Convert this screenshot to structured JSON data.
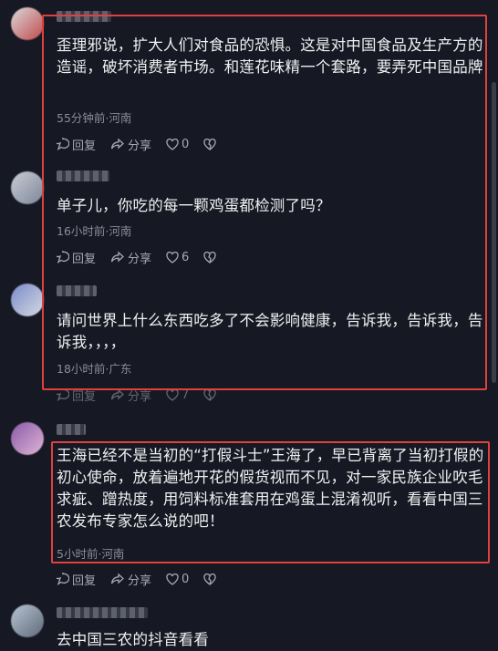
{
  "comments": [
    {
      "text": "歪理邪说，扩大人们对食品的恐惧。这是对中国食品及生产方的造谣，破坏消费者市场。和莲花味精一个套路，要弄死中国品牌",
      "meta": "55分钟前·河南",
      "reply": "回复",
      "share": "分享",
      "likes": "0"
    },
    {
      "text": "单子儿，你吃的每一颗鸡蛋都检测了吗？",
      "meta": "16小时前·河南",
      "reply": "回复",
      "share": "分享",
      "likes": "6"
    },
    {
      "text": "请问世界上什么东西吃多了不会影响健康，告诉我，告诉我，告诉我，，，，",
      "meta": "18小时前·广东",
      "reply": "回复",
      "share": "分享",
      "likes": "7"
    },
    {
      "text": "王海已经不是当初的“打假斗士”王海了，早已背离了当初打假的初心使命，放着遍地开花的假货视而不见，对一家民族企业吹毛求疵、蹭热度，用饲料标准套用在鸡蛋上混淆视听，看看中国三农发布专家怎么说的吧！",
      "meta": "5小时前·河南",
      "reply": "回复",
      "share": "分享",
      "likes": "0"
    },
    {
      "text": "去中国三农的抖音看看"
    }
  ],
  "colors": {
    "highlight": "#e0413e",
    "background": "#161823"
  }
}
